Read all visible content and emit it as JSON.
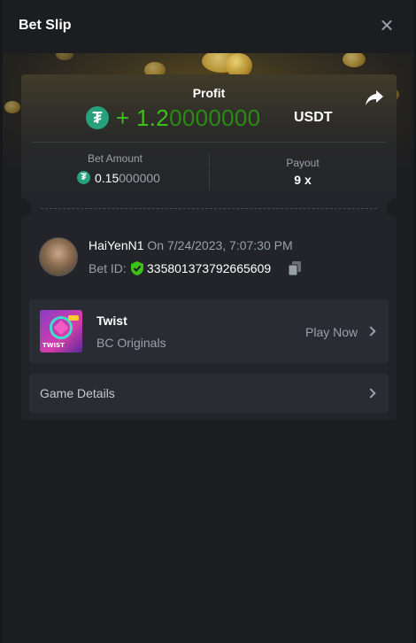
{
  "header": {
    "title": "Bet Slip"
  },
  "profit": {
    "label": "Profit",
    "sign": "+ ",
    "value_main": "1.2",
    "value_trailing": "0000000",
    "currency": "USDT"
  },
  "bet_amount": {
    "label": "Bet Amount",
    "value_main": "0.15",
    "value_trailing": "000000"
  },
  "payout": {
    "label": "Payout",
    "value": "9 x"
  },
  "user": {
    "name": "HaiYenN1",
    "timestamp": "On 7/24/2023, 7:07:30 PM",
    "bet_id_label": "Bet ID:",
    "bet_id": "335801373792665609"
  },
  "game": {
    "name": "Twist",
    "provider": "BC Originals",
    "action": "Play Now",
    "thumb_text": "TWIST"
  },
  "details": {
    "label": "Game Details"
  },
  "icons": {
    "close": "close-icon",
    "share": "share-icon",
    "tether": "tether-icon",
    "shield": "shield-check-icon",
    "copy": "copy-icon",
    "chevron": "chevron-right-icon"
  },
  "colors": {
    "profit_green": "#3bc117",
    "tether": "#26a17b",
    "background": "#1c1d20",
    "card": "#22242a"
  }
}
